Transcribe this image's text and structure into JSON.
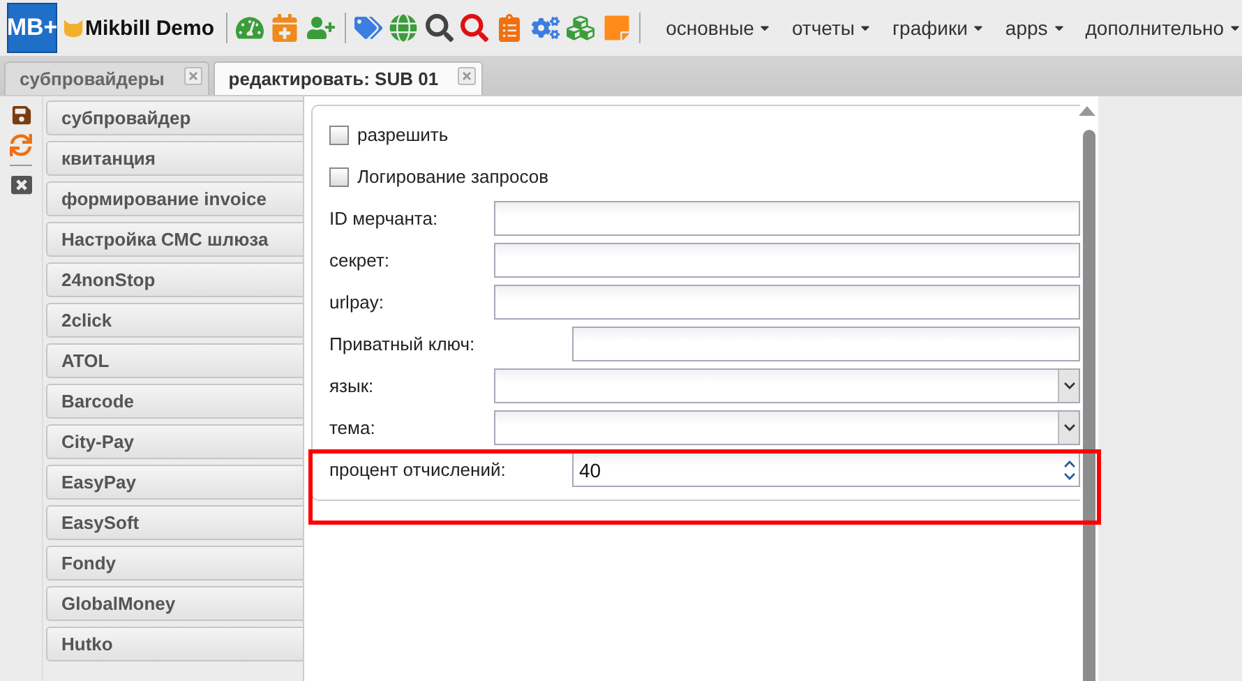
{
  "toolbar": {
    "logo": "MB+",
    "brand": "Mikbill Demo",
    "menus": [
      {
        "label": "основные"
      },
      {
        "label": "отчеты"
      },
      {
        "label": "графики"
      },
      {
        "label": "apps"
      },
      {
        "label": "дополнительно"
      }
    ]
  },
  "tabs": [
    {
      "label": "субпровайдеры",
      "selected": false
    },
    {
      "label": "редактировать: SUB 01",
      "selected": true
    }
  ],
  "side_menu": {
    "items": [
      {
        "label": "субпровайдер"
      },
      {
        "label": "квитанция"
      },
      {
        "label": "формирование invoice"
      },
      {
        "label": "Настройка СМС шлюза"
      },
      {
        "label": "24nonStop"
      },
      {
        "label": "2click"
      },
      {
        "label": "ATOL"
      },
      {
        "label": "Barcode"
      },
      {
        "label": "City-Pay"
      },
      {
        "label": "EasyPay"
      },
      {
        "label": "EasySoft"
      },
      {
        "label": "Fondy"
      },
      {
        "label": "GlobalMoney"
      },
      {
        "label": "Hutko"
      }
    ]
  },
  "form": {
    "fields": [
      {
        "kind": "checkbox",
        "label": "разрешить",
        "checked": false
      },
      {
        "kind": "checkbox",
        "label": "Логирование запросов",
        "checked": false
      },
      {
        "kind": "text",
        "label": "ID мерчанта:"
      },
      {
        "kind": "text",
        "label": "секрет:"
      },
      {
        "kind": "text",
        "label": "urlpay:"
      },
      {
        "kind": "text",
        "label": "Приватный ключ:"
      },
      {
        "kind": "select",
        "label": "язык:"
      },
      {
        "kind": "select",
        "label": "тема:"
      },
      {
        "kind": "number",
        "label": "процент отчислений:",
        "value": "40",
        "highlighted": true
      }
    ]
  }
}
